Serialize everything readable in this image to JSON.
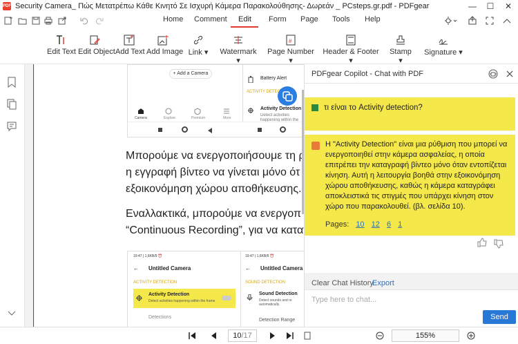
{
  "window": {
    "title": "Security Camera_ Πώς Μετατρέπω Κάθε Κινητό Σε Ισχυρή Κάμερα Παρακολούθησης- Δωρεάν _ PCsteps.gr.pdf - PDFgear",
    "logo": "PDF",
    "minimize": "—",
    "maximize": "☐",
    "close": "✕"
  },
  "menu": {
    "home": "Home",
    "comment": "Comment",
    "edit": "Edit",
    "form": "Form",
    "page": "Page",
    "tools": "Tools",
    "help": "Help"
  },
  "toolbar": {
    "edit_text": "Edit Text",
    "edit_object": "Edit Object",
    "add_text": "Add Text",
    "add_image": "Add Image",
    "link": "Link",
    "watermark": "Watermark",
    "page_number": "Page Number",
    "header_footer": "Header & Footer",
    "stamp": "Stamp",
    "signature": "Signature"
  },
  "document": {
    "shot1": {
      "add_camera": "+ Add a Camera",
      "battery_alert": "Battery Alert",
      "activity_section": "ACTIVITY DETECTION",
      "activity_detection": "Activity Detection",
      "activity_desc": "Detect activities happening within the frame",
      "tabs": [
        "Camera",
        "Explore",
        "Premium",
        "More"
      ]
    },
    "para1_line1": "Μπορούμε να ενεργοποιήσουμε τη ρ",
    "para1_line2": "η εγγραφή βίντεο να γίνεται μόνο ότ",
    "para1_line3": "εξοικονόμηση χώρου αποθήκευσης.",
    "para2_line1": "Εναλλακτικά, μπορούμε να ενεργοπ",
    "para2_line2": "“Continuous Recording”, για να καταγ",
    "shot2": {
      "status_left": "19:47 | 1,6KB/δ ⏰",
      "status_right": "19:47 | 1,6KB/δ ⏰",
      "title_left": "Untitled Camera",
      "title_right": "Untitled Camera",
      "section_left": "ACTIVITY DETECTION",
      "section_right": "SOUND DETECTION",
      "item_left": "Activity Detection",
      "item_left_desc": "Detect activities happening within the frame",
      "item_right": "Sound Detection",
      "item_right_desc": "Detect sounds and re automatically.",
      "bottom_left": "Detections",
      "bottom_right": "Detection Range"
    }
  },
  "copilot": {
    "title": "PDFgear Copilot - Chat with PDF",
    "question": "τι είναι το Activity detection?",
    "answer": "Η \"Activity Detection\" είναι μια ρύθμιση που μπορεί να ενεργοποιηθεί στην κάμερα ασφαλείας, η οποία επιτρέπει την καταγραφή βίντεο μόνο όταν εντοπίζεται κίνηση. Αυτή η λειτουργία βοηθά στην εξοικονόμηση χώρου αποθήκευσης, καθώς η κάμερα καταγράφει αποκλειστικά τις στιγμές που υπάρχει κίνηση στον χώρο που παρακολουθεί. (βλ. σελίδα 10).",
    "pages_label": "Pages:",
    "pages": [
      "10",
      "12",
      "6",
      "1"
    ],
    "clear_chat": "Clear Chat History",
    "export": "Export",
    "input_placeholder": "Type here to chat...",
    "send": "Send"
  },
  "status": {
    "page_current": "10",
    "page_total": "/17",
    "zoom": "155%"
  },
  "colors": {
    "accent_red": "#e03a2f",
    "highlight_yellow": "#f5e84a",
    "send_blue": "#2878d6"
  }
}
